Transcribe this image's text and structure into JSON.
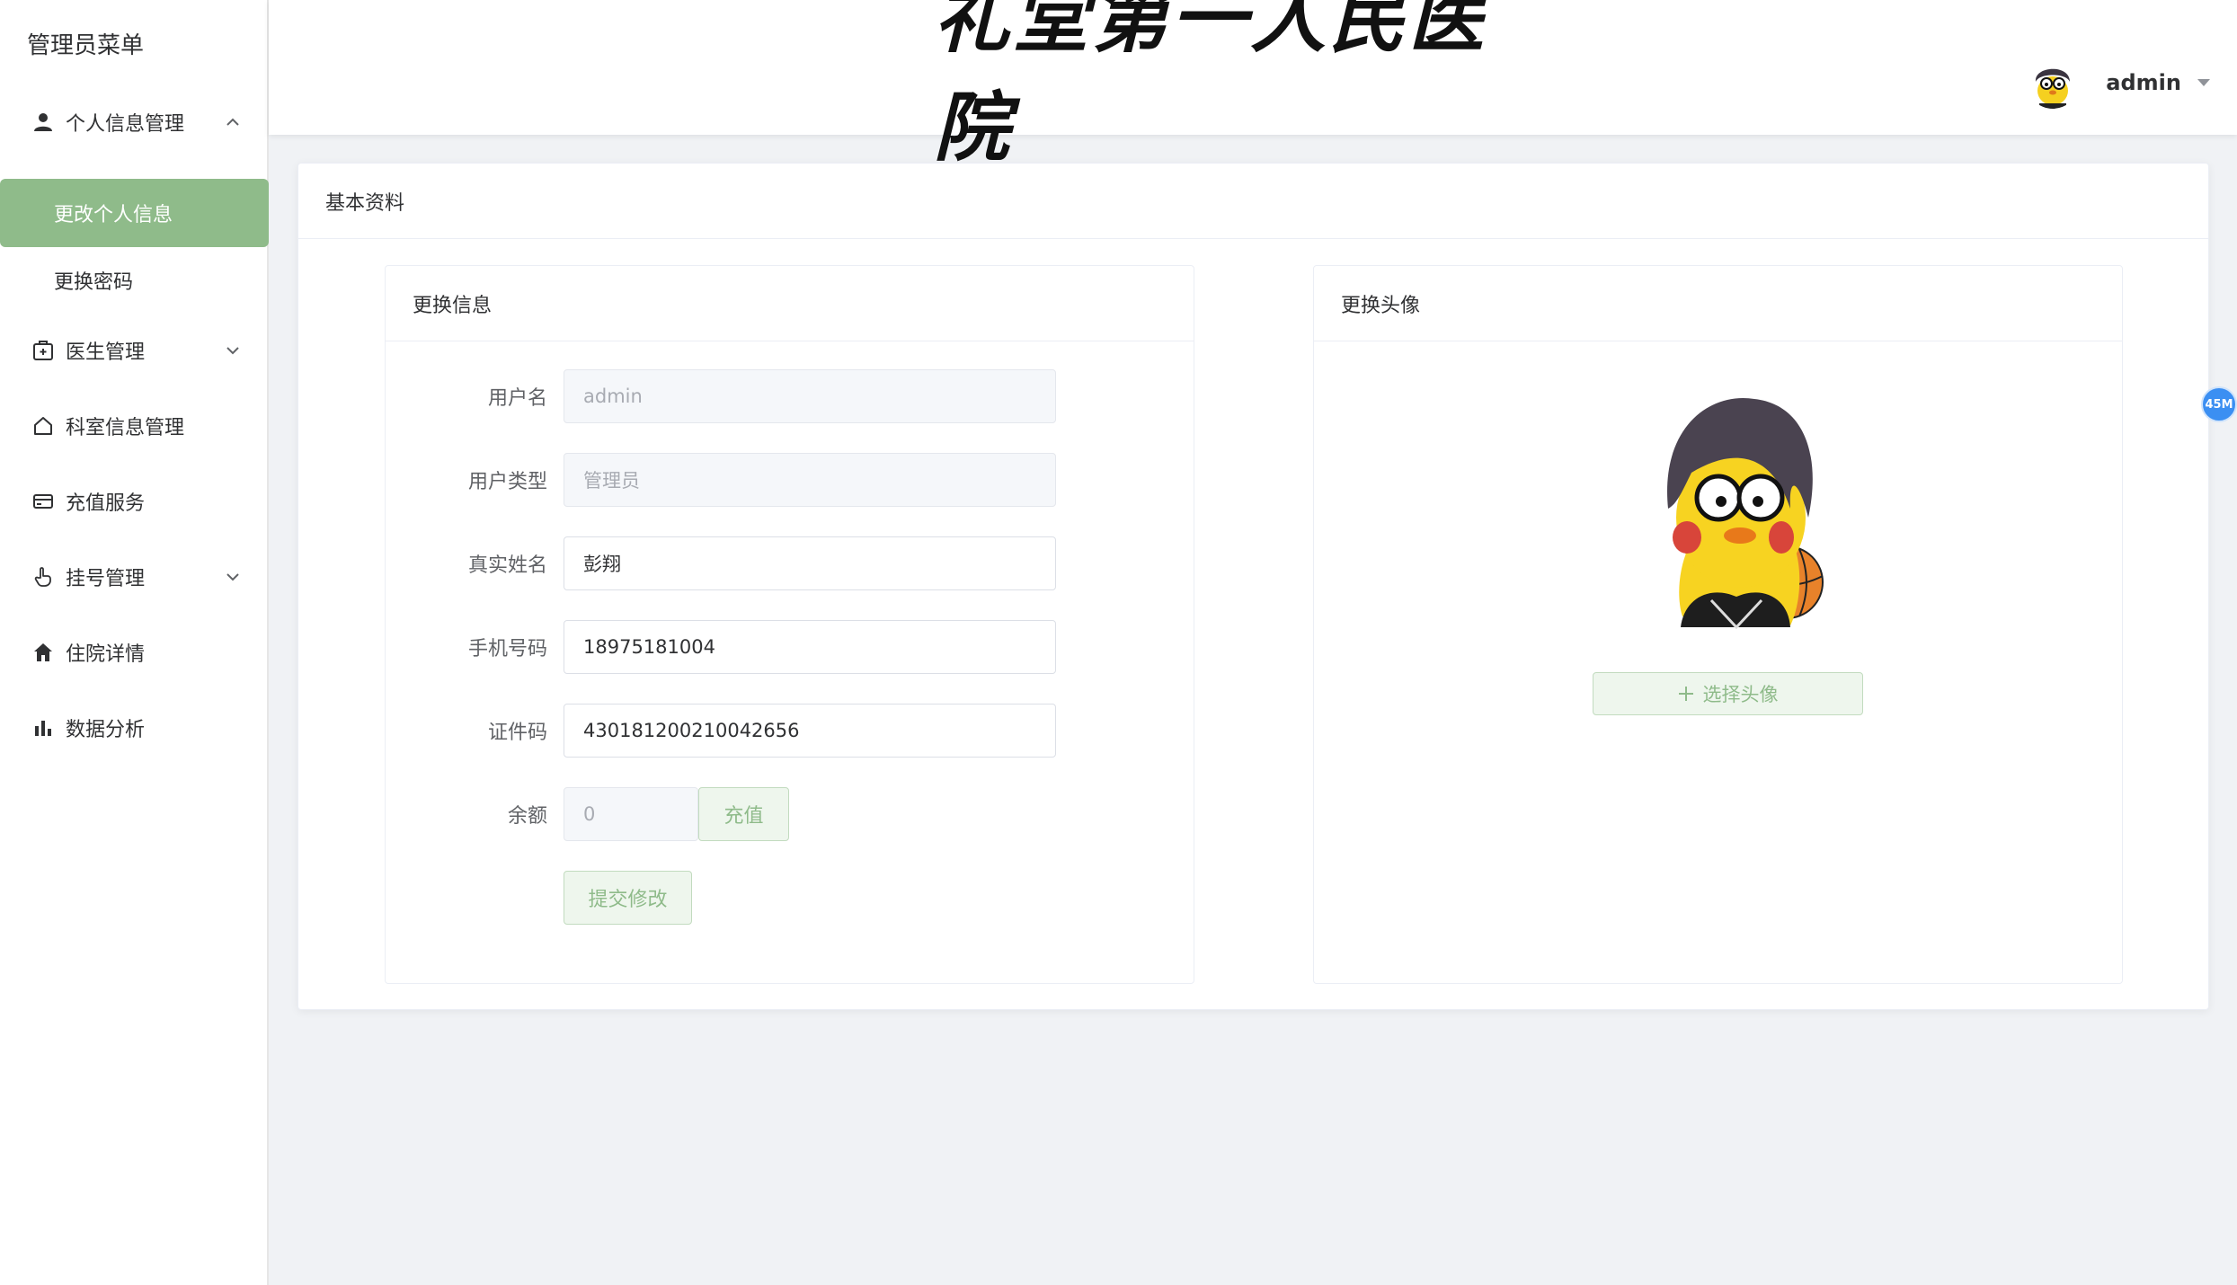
{
  "sidebar": {
    "title": "管理员菜单",
    "menu": [
      {
        "label": "个人信息管理",
        "icon": "user-icon",
        "expanded": true
      },
      {
        "label": "医生管理",
        "icon": "medical-box-icon",
        "expanded": false
      },
      {
        "label": "科室信息管理",
        "icon": "house-icon"
      },
      {
        "label": "充值服务",
        "icon": "credit-card-icon"
      },
      {
        "label": "挂号管理",
        "icon": "pointer-hand-icon",
        "expanded": false
      },
      {
        "label": "住院详情",
        "icon": "home-filled-icon"
      },
      {
        "label": "数据分析",
        "icon": "bar-chart-icon"
      }
    ],
    "submenu": [
      {
        "label": "更改个人信息",
        "active": true
      },
      {
        "label": "更换密码",
        "active": false
      }
    ],
    "active_color": "#8fbb8a"
  },
  "header": {
    "brand": "礼堂第一人民医院",
    "user_name": "admin"
  },
  "card": {
    "title": "基本资料",
    "info_panel": {
      "title": "更换信息",
      "fields": [
        {
          "label": "用户名",
          "value": "admin",
          "disabled": true
        },
        {
          "label": "用户类型",
          "value": "管理员",
          "disabled": true
        },
        {
          "label": "真实姓名",
          "value": "彭翔",
          "disabled": false
        },
        {
          "label": "手机号码",
          "value": "18975181004",
          "disabled": false
        },
        {
          "label": "证件码",
          "value": "430181200210042656",
          "disabled": false
        }
      ],
      "balance_label": "余额",
      "balance_value": "0",
      "recharge_button": "充值",
      "submit_button": "提交修改"
    },
    "avatar_panel": {
      "title": "更换头像",
      "choose_button": "选择头像",
      "choose_icon": "plus-icon"
    }
  },
  "floating_badge": "45M"
}
